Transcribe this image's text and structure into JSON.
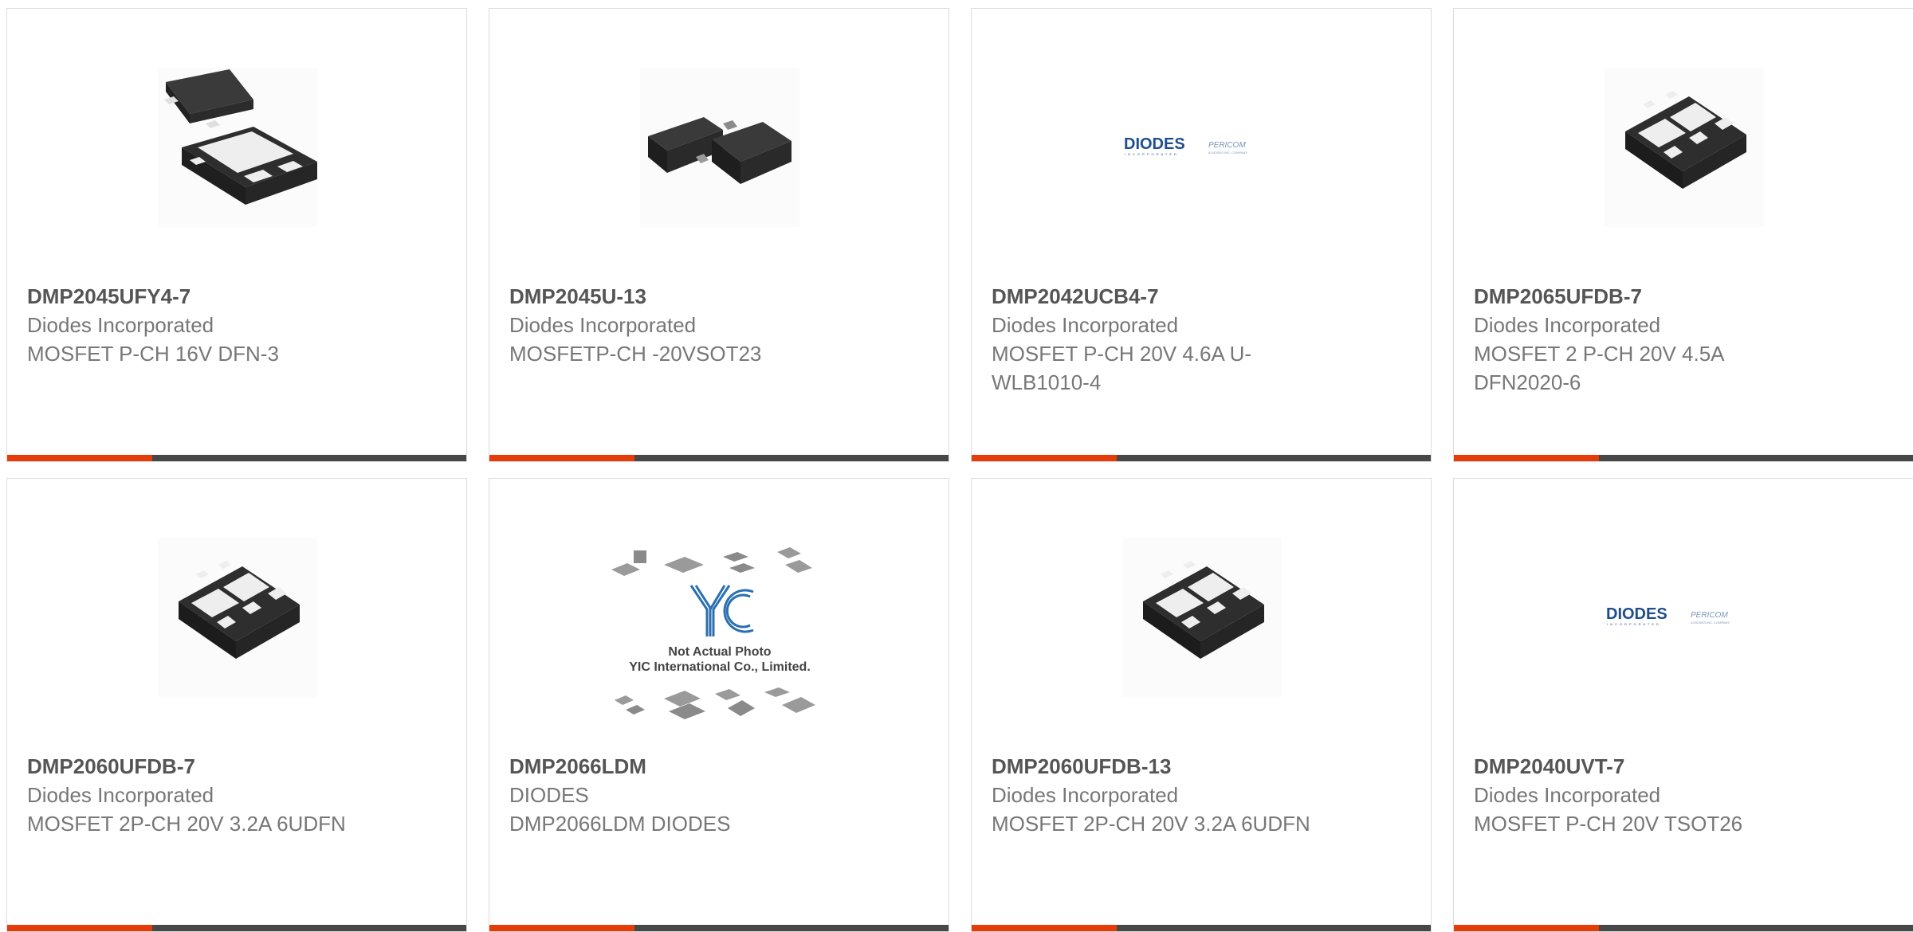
{
  "products": [
    {
      "part_number": "DMP2045UFY4-7",
      "manufacturer": "Diodes Incorporated",
      "description": "MOSFET P-CH 16V DFN-3",
      "image": "dfn3-package-icon"
    },
    {
      "part_number": "DMP2045U-13",
      "manufacturer": "Diodes Incorporated",
      "description": "MOSFETP-CH -20VSOT23",
      "image": "sot23-package-icon"
    },
    {
      "part_number": "DMP2042UCB4-7",
      "manufacturer": "Diodes Incorporated",
      "description": "MOSFET P-CH 20V 4.6A U-WLB1010-4",
      "image": "diodes-pericom-logo"
    },
    {
      "part_number": "DMP2065UFDB-7",
      "manufacturer": "Diodes Incorporated",
      "description": "MOSFET 2 P-CH 20V 4.5A DFN2020-6",
      "image": "dfn6-package-icon"
    },
    {
      "part_number": "DMP2060UFDB-7",
      "manufacturer": "Diodes Incorporated",
      "description": "MOSFET 2P-CH 20V 3.2A 6UDFN",
      "image": "dfn6-package-icon"
    },
    {
      "part_number": "DMP2066LDM",
      "manufacturer": "DIODES",
      "description": "DMP2066LDM DIODES",
      "image": "yic-placeholder"
    },
    {
      "part_number": "DMP2060UFDB-13",
      "manufacturer": "Diodes Incorporated",
      "description": "MOSFET 2P-CH 20V 3.2A 6UDFN",
      "image": "dfn6-package-icon"
    },
    {
      "part_number": "DMP2040UVT-7",
      "manufacturer": "Diodes Incorporated",
      "description": "MOSFET P-CH 20V TSOT26",
      "image": "diodes-pericom-logo"
    }
  ],
  "logos": {
    "diodes_brand": "DIODES",
    "diodes_sub": "INCORPORATED",
    "pericom_brand": "PERICOM",
    "pericom_sub": "A DIODES INC. COMPANY"
  },
  "placeholder": {
    "brand": "YIC",
    "line1": "Not Actual Photo",
    "line2": "YIC International Co., Limited."
  },
  "colors": {
    "accent": "#e63c0a",
    "bar": "#474747",
    "diodes_blue": "#1f4e8c",
    "yic_blue": "#2a6fb0"
  }
}
